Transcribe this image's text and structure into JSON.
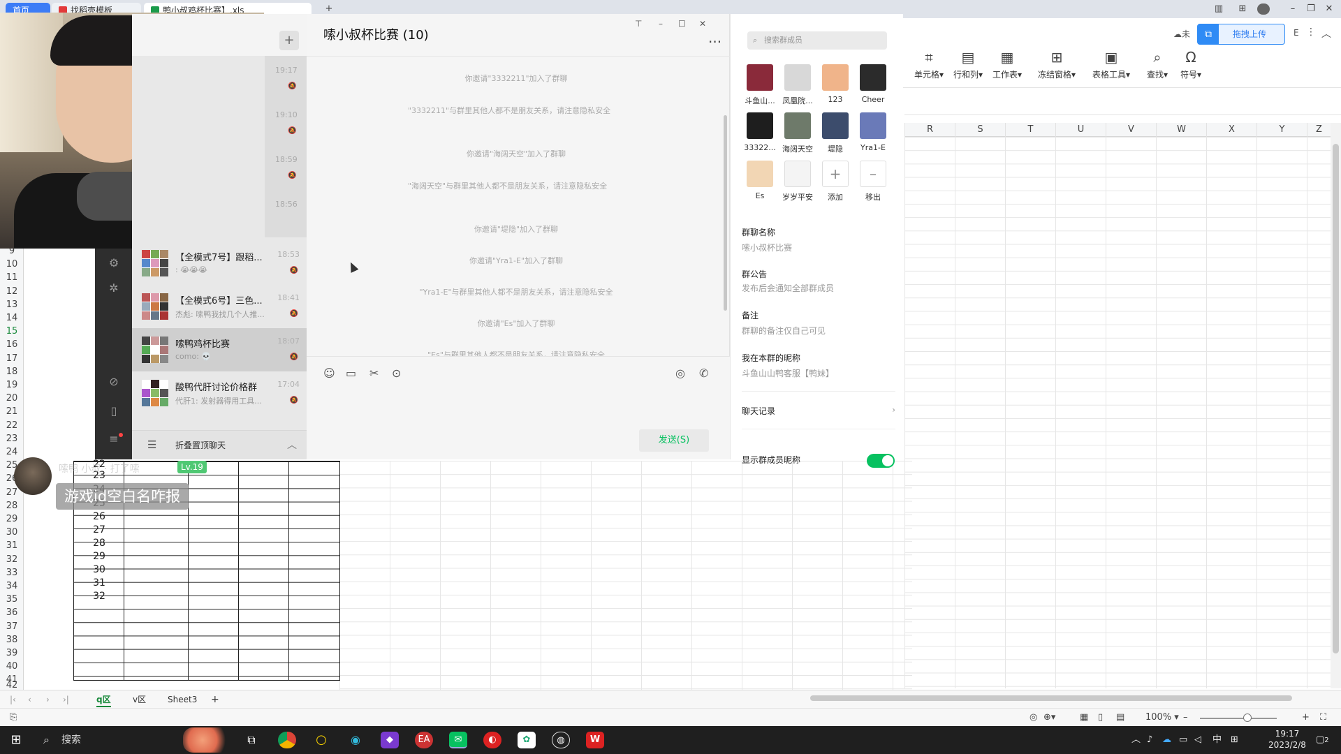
{
  "tabs": {
    "home": "首页",
    "tab2": "找稻壳模板",
    "tab3": "鸭小叔鸡杯比赛】.xls",
    "new_tab": "+"
  },
  "ribbon": {
    "partial_label": "未",
    "upload_label": "拖拽上传",
    "buttons": [
      {
        "label": "单元格",
        "icon": "cell-icon"
      },
      {
        "label": "行和列",
        "icon": "row-col-icon"
      },
      {
        "label": "工作表",
        "icon": "sheet-icon"
      },
      {
        "label": "冻结窗格",
        "icon": "freeze-icon"
      },
      {
        "label": "表格工具",
        "icon": "table-tools-icon"
      },
      {
        "label": "查找",
        "icon": "search-icon"
      },
      {
        "label": "符号",
        "icon": "omega-icon"
      }
    ]
  },
  "sheet": {
    "columns": [
      "R",
      "S",
      "T",
      "U",
      "V",
      "W",
      "X",
      "Y",
      "Z"
    ],
    "row_numbers": [
      "9",
      "10",
      "11",
      "12",
      "13",
      "14",
      "15",
      "16",
      "17",
      "18",
      "19",
      "20",
      "21",
      "22",
      "23",
      "24",
      "25",
      "26",
      "27",
      "28",
      "29",
      "30",
      "31",
      "32",
      "33",
      "34",
      "35",
      "36",
      "37",
      "38",
      "39",
      "40",
      "41",
      "42"
    ],
    "selected_row": "15",
    "cell_values": [
      "22",
      "23",
      "24",
      "25",
      "26",
      "27",
      "28",
      "29",
      "30",
      "31",
      "32"
    ],
    "tabs": [
      "q区",
      "v区",
      "Sheet3"
    ],
    "active_tab": "q区",
    "zoom": "100%"
  },
  "wechat": {
    "list_timestamps": [
      "19:17",
      "19:10",
      "18:59",
      "18:56"
    ],
    "chats": [
      {
        "title": "【全模式7号】跟稻...",
        "preview": ": 😭😭😭",
        "time": "18:53"
      },
      {
        "title": "【全模式6号】三色...",
        "preview": "杰彪: 嗦鸭我找几个人推...",
        "time": "18:41"
      },
      {
        "title": "嗦鸭鸡杯比赛",
        "preview": "como: 💀",
        "time": "18:07"
      },
      {
        "title": "酸鸭代肝讨论价格群",
        "preview": "代肝1: 发射器得用工具...",
        "time": "17:04"
      }
    ],
    "fold_label": "折叠置顶聊天"
  },
  "chat": {
    "title": "嗦小叔杯比赛 (10)",
    "messages": [
      "你邀请\"3332211\"加入了群聊",
      "\"3332211\"与群里其他人都不是朋友关系，请注意隐私安全",
      "你邀请\"海阔天空\"加入了群聊",
      "\"海阔天空\"与群里其他人都不是朋友关系，请注意隐私安全",
      "你邀请\"堤隐\"加入了群聊",
      "你邀请\"Yra1-E\"加入了群聊",
      "\"Yra1-E\"与群里其他人都不是朋友关系，请注意隐私安全",
      "你邀请\"Es\"加入了群聊",
      "\"Es\"与群里其他人都不是朋友关系，请注意隐私安全"
    ],
    "send_label": "发送(S)"
  },
  "group": {
    "search_placeholder": "搜索群成员",
    "members": [
      {
        "name": "斗鱼山...",
        "color": "#8a2a3a"
      },
      {
        "name": "凤凰院...",
        "color": "#d8d8d8"
      },
      {
        "name": "123",
        "color": "#f0b48a"
      },
      {
        "name": "Cheer",
        "color": "#2b2b2b"
      },
      {
        "name": "33322...",
        "color": "#1e1e1e"
      },
      {
        "name": "海阔天空",
        "color": "#6e7a6a"
      },
      {
        "name": "堤隐",
        "color": "#3c4c6c"
      },
      {
        "name": "Yra1-E",
        "color": "#6a7ab8"
      },
      {
        "name": "Es",
        "color": "#f2d6b4"
      },
      {
        "name": "岁岁平安",
        "color": "#f4f4f4"
      }
    ],
    "add_label": "添加",
    "remove_label": "移出",
    "name_title": "群聊名称",
    "name_value": "嗦小叔杯比赛",
    "notice_title": "群公告",
    "notice_value": "发布后会通知全部群成员",
    "remark_title": "备注",
    "remark_value": "群聊的备注仅自己可见",
    "nick_title": "我在本群的昵称",
    "nick_value": "斗鱼山山鸭客服【鸭妹】",
    "history_label": "聊天记录",
    "show_name_label": "显示群成员昵称"
  },
  "live": {
    "username": "嗦鸭 小叔 · 打了嗦",
    "level": "Lv.19",
    "message": "游戏id空白名咋报"
  },
  "taskbar": {
    "search_label": "搜索",
    "ime": "中",
    "time": "19:17",
    "date": "2023/2/8",
    "notifications": "2"
  }
}
